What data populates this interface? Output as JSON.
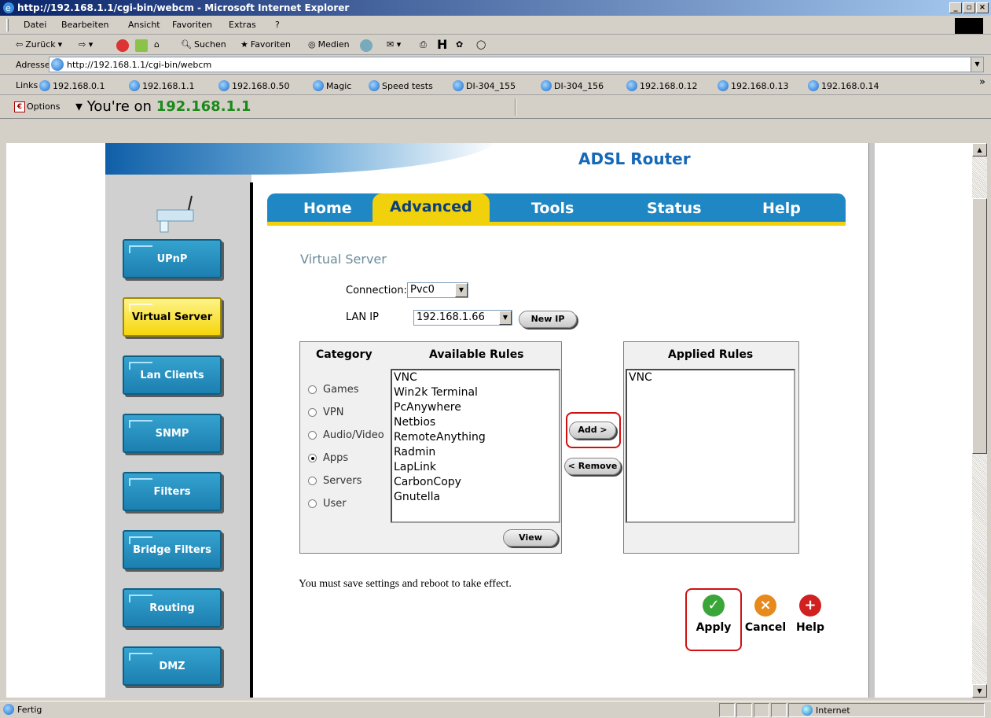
{
  "window": {
    "title": "http://192.168.1.1/cgi-bin/webcm - Microsoft Internet Explorer",
    "min_label": "_",
    "max_label": "▫",
    "close_label": "×"
  },
  "menu": {
    "items": [
      "Datei",
      "Bearbeiten",
      "Ansicht",
      "Favoriten",
      "Extras",
      "?"
    ]
  },
  "toolbar": {
    "back_label": "Zurück",
    "search_label": "Suchen",
    "favorites_label": "Favoriten",
    "media_label": "Medien"
  },
  "address": {
    "label": "Adresse",
    "url": "http://192.168.1.1/cgi-bin/webcm"
  },
  "links": {
    "label": "Links",
    "items": [
      "192.168.0.1",
      "192.168.1.1",
      "192.168.0.50",
      "Magic",
      "Speed tests",
      "DI-304_155",
      "DI-304_156",
      "192.168.0.12",
      "192.168.0.13",
      "192.168.0.14"
    ],
    "more": "»"
  },
  "optbar": {
    "options_label": "Options",
    "youre_label": "You're on",
    "ip": "192.168.1.1"
  },
  "router": {
    "header_title": "ADSL Router",
    "tabs": [
      "Home",
      "Advanced",
      "Tools",
      "Status",
      "Help"
    ],
    "active_tab": "Advanced",
    "sidebar": [
      "UPnP",
      "Virtual Server",
      "Lan Clients",
      "SNMP",
      "Filters",
      "Bridge Filters",
      "Routing",
      "DMZ"
    ],
    "active_sidebar": "Virtual Server",
    "page_title": "Virtual Server",
    "connection_label": "Connection:",
    "connection_value": "Pvc0",
    "lan_ip_label": "LAN IP",
    "lan_ip_value": "192.168.1.66",
    "new_ip_label": "New IP",
    "category_header": "Category",
    "available_header": "Available Rules",
    "applied_header": "Applied Rules",
    "categories": [
      "Games",
      "VPN",
      "Audio/Video",
      "Apps",
      "Servers",
      "User"
    ],
    "selected_category": "Apps",
    "available_rules": [
      "VNC",
      "Win2k Terminal",
      "PcAnywhere",
      "Netbios",
      "RemoteAnything",
      "Radmin",
      "LapLink",
      "CarbonCopy",
      "Gnutella"
    ],
    "applied_rules": [
      "VNC"
    ],
    "add_label": "Add >",
    "remove_label": "< Remove",
    "view_label": "View",
    "note": "You must save settings and reboot to take effect.",
    "apply_label": "Apply",
    "cancel_label": "Cancel",
    "help_label": "Help"
  },
  "status": {
    "text": "Fertig",
    "zone": "Internet"
  },
  "colors": {
    "tab_blue": "#1e87c4",
    "tab_yellow": "#f1d10c",
    "sidebar_button": "#2591c0",
    "highlight_red": "#d01010",
    "ip_green": "#1a8a1a"
  }
}
